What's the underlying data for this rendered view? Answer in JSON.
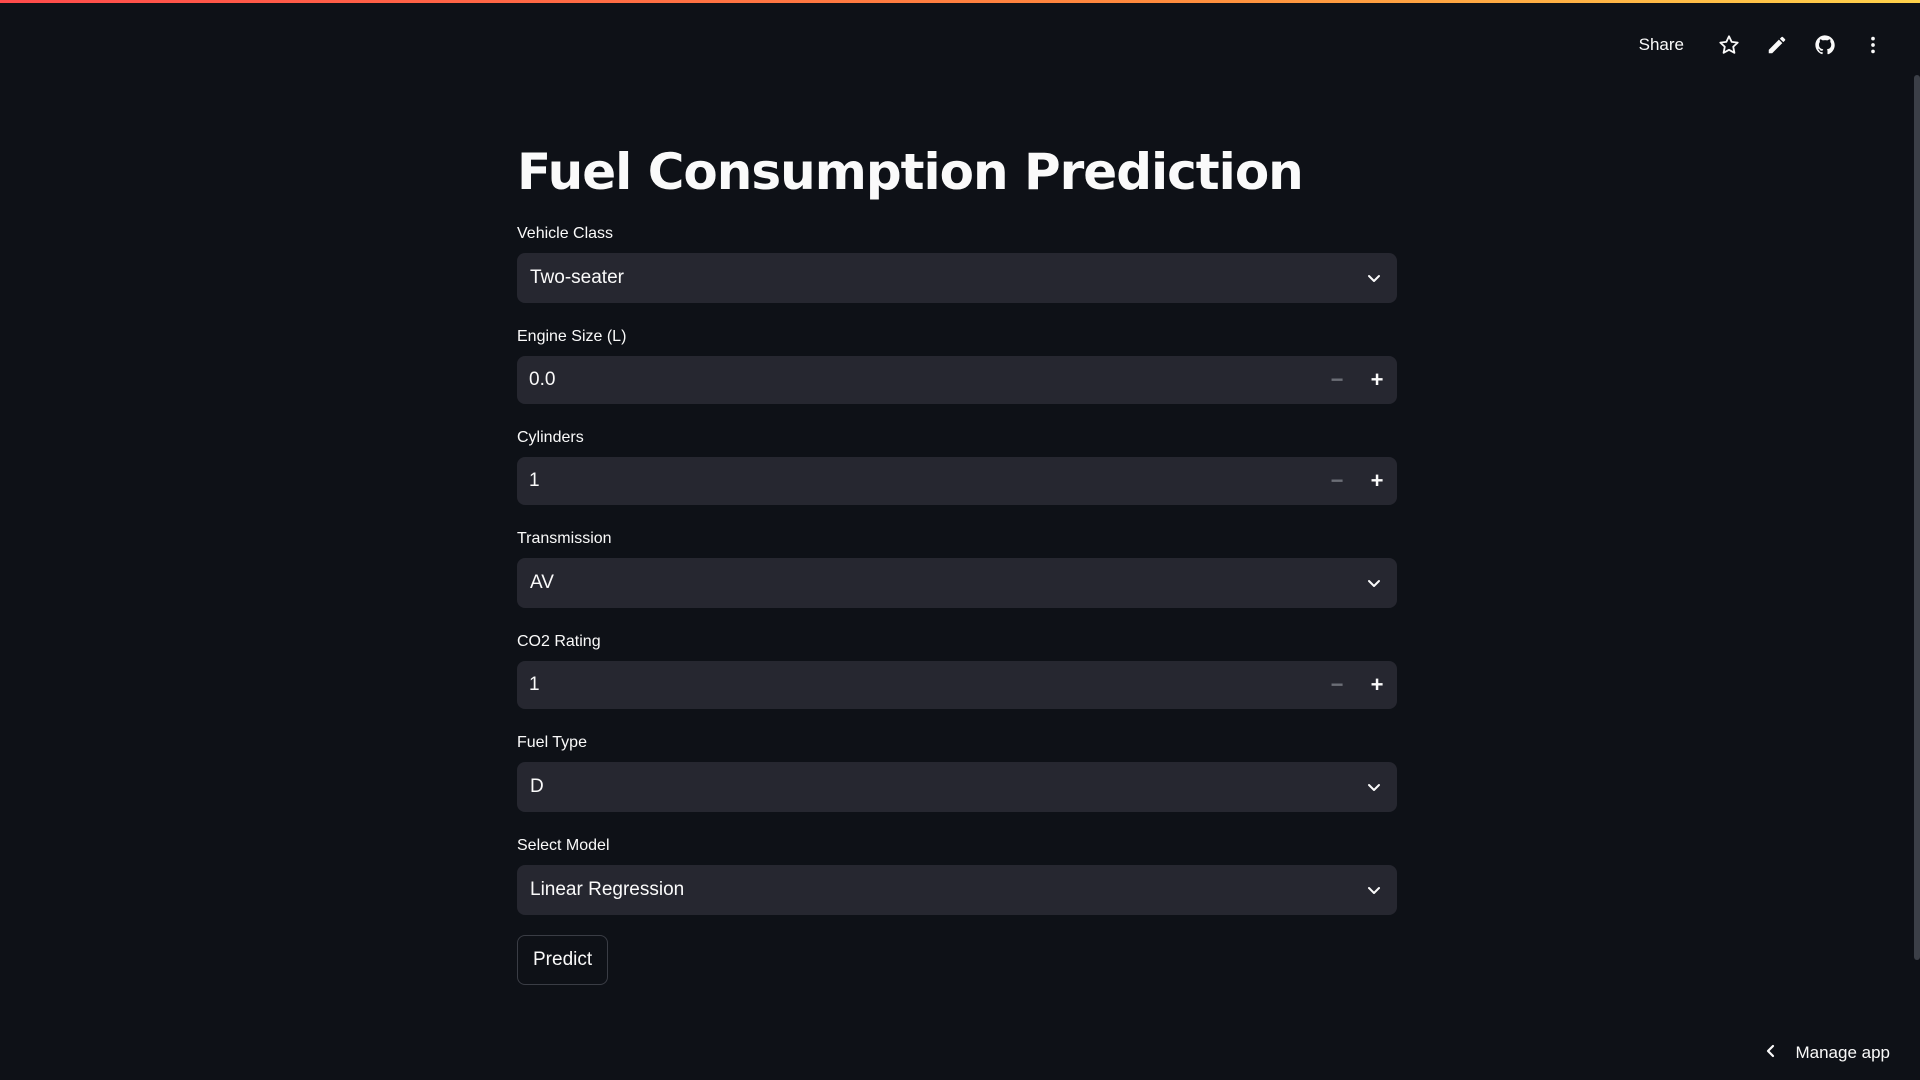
{
  "header": {
    "share_label": "Share",
    "icons": [
      "star-icon",
      "pencil-icon",
      "github-icon",
      "kebab-menu-icon"
    ]
  },
  "main": {
    "title": "Fuel Consumption Prediction",
    "vehicle_class": {
      "label": "Vehicle Class",
      "value": "Two-seater"
    },
    "engine_size": {
      "label": "Engine Size (L)",
      "value": "0.0"
    },
    "cylinders": {
      "label": "Cylinders",
      "value": "1"
    },
    "transmission": {
      "label": "Transmission",
      "value": "AV"
    },
    "co2_rating": {
      "label": "CO2 Rating",
      "value": "1"
    },
    "fuel_type": {
      "label": "Fuel Type",
      "value": "D"
    },
    "model": {
      "label": "Select Model",
      "value": "Linear Regression"
    },
    "predict_label": "Predict"
  },
  "footer": {
    "manage_app_label": "Manage app"
  },
  "colors": {
    "background": "#0e1117",
    "input_bg": "#262730",
    "text": "#fafafa",
    "accent_gradient_start": "#ff4b4b",
    "accent_gradient_end": "#ffd24b"
  }
}
